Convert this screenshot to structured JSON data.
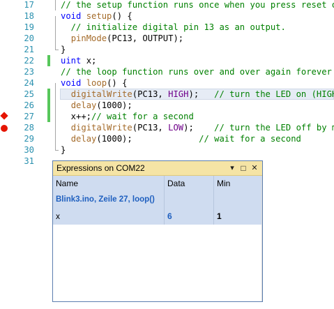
{
  "editor": {
    "lines": [
      {
        "num": "17",
        "code": [
          {
            "c": "cm",
            "t": "// the setup function runs once when you press reset or"
          }
        ]
      },
      {
        "num": "18",
        "code": [
          {
            "c": "kw",
            "t": "void"
          },
          {
            "c": "",
            "t": " "
          },
          {
            "c": "fn",
            "t": "setup"
          },
          {
            "c": "",
            "t": "() {"
          }
        ]
      },
      {
        "num": "19",
        "code": [
          {
            "c": "cm",
            "t": "  // initialize digital pin 13 as an output."
          }
        ]
      },
      {
        "num": "20",
        "code": [
          {
            "c": "",
            "t": "  "
          },
          {
            "c": "fn",
            "t": "pinMode"
          },
          {
            "c": "",
            "t": "(PC13, OUTPUT);"
          }
        ]
      },
      {
        "num": "21",
        "code": [
          {
            "c": "",
            "t": "}"
          }
        ]
      },
      {
        "num": "22",
        "code": [
          {
            "c": "kw",
            "t": "uint"
          },
          {
            "c": "",
            "t": " x;"
          }
        ]
      },
      {
        "num": "23",
        "code": [
          {
            "c": "cm",
            "t": "// the loop function runs over and over again forever"
          }
        ]
      },
      {
        "num": "24",
        "code": [
          {
            "c": "kw",
            "t": "void"
          },
          {
            "c": "",
            "t": " "
          },
          {
            "c": "fn",
            "t": "loop"
          },
          {
            "c": "",
            "t": "() {"
          }
        ]
      },
      {
        "num": "25",
        "code": [
          {
            "c": "",
            "t": "  "
          },
          {
            "c": "fn",
            "t": "digitalWrite"
          },
          {
            "c": "",
            "t": "(PC13, "
          },
          {
            "c": "mc",
            "t": "HIGH"
          },
          {
            "c": "",
            "t": ");   "
          },
          {
            "c": "cm",
            "t": "// turn the LED on (HIGH i"
          }
        ]
      },
      {
        "num": "26",
        "code": [
          {
            "c": "",
            "t": "  "
          },
          {
            "c": "fn",
            "t": "delay"
          },
          {
            "c": "",
            "t": "(1000);"
          }
        ]
      },
      {
        "num": "27",
        "code": [
          {
            "c": "",
            "t": "  x++;"
          },
          {
            "c": "cm",
            "t": "// wait for a second"
          }
        ]
      },
      {
        "num": "28",
        "code": [
          {
            "c": "",
            "t": "  "
          },
          {
            "c": "fn",
            "t": "digitalWrite"
          },
          {
            "c": "",
            "t": "(PC13, "
          },
          {
            "c": "mc",
            "t": "LOW"
          },
          {
            "c": "",
            "t": ");    "
          },
          {
            "c": "cm",
            "t": "// turn the LED off by mak"
          }
        ]
      },
      {
        "num": "29",
        "code": [
          {
            "c": "",
            "t": "  "
          },
          {
            "c": "fn",
            "t": "delay"
          },
          {
            "c": "",
            "t": "(1000);             "
          },
          {
            "c": "cm",
            "t": "// wait for a second"
          }
        ]
      },
      {
        "num": "30",
        "code": [
          {
            "c": "",
            "t": "}"
          }
        ]
      },
      {
        "num": "31",
        "code": []
      }
    ]
  },
  "expressions": {
    "title": "Expressions on COM22",
    "columns": {
      "name": "Name",
      "data": "Data",
      "min": "Min"
    },
    "context_row": "Blink3.ino, Zeile 27, loop()",
    "rows": [
      {
        "name": "x",
        "data": "6",
        "min": "1"
      }
    ],
    "buttons": {
      "dropdown": "▾",
      "maximize": "□",
      "close": "✕"
    }
  }
}
